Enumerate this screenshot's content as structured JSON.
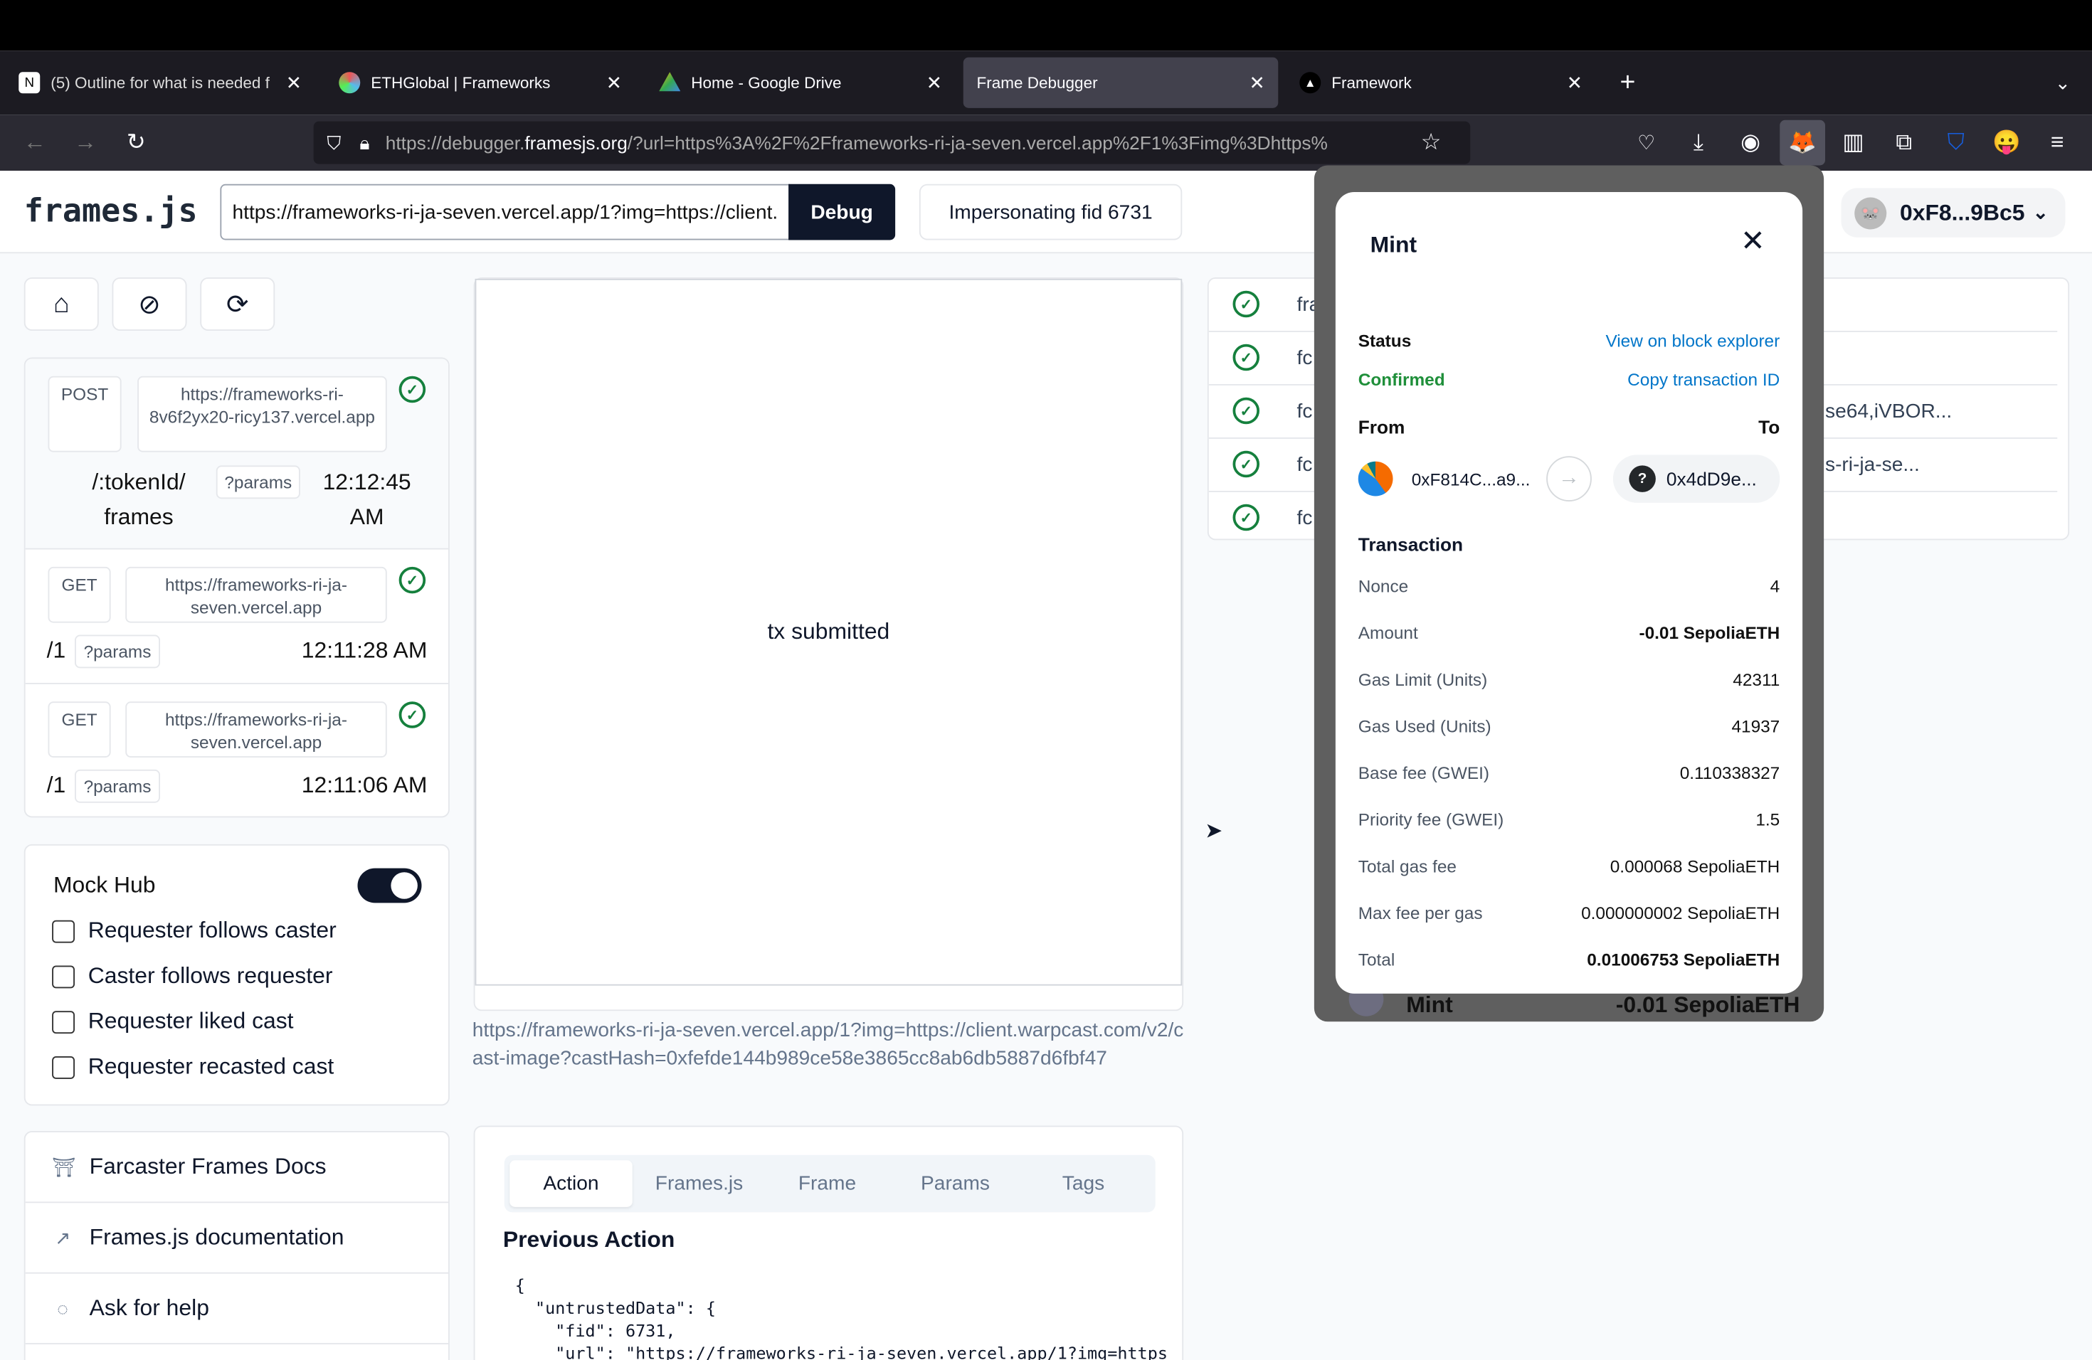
{
  "browser": {
    "tabs": [
      {
        "title": "(5) Outline for what is needed f",
        "icon": "notion-icon"
      },
      {
        "title": "ETHGlobal | Frameworks",
        "icon": "ethglobal-icon"
      },
      {
        "title": "Home - Google Drive",
        "icon": "google-drive-icon"
      },
      {
        "title": "Frame Debugger",
        "icon": "",
        "active": true
      },
      {
        "title": "Framework",
        "icon": "vercel-icon"
      }
    ],
    "url_prefix": "https://debugger.",
    "url_host": "framesjs.org",
    "url_rest": "/?url=https%3A%2F%2Fframeworks-ri-ja-seven.vercel.app%2F1%3Fimg%3Dhttps%"
  },
  "header": {
    "logo": "frames.js",
    "url_value": "https://frameworks-ri-ja-seven.vercel.app/1?img=https://client.warpcast.com/v2/cast-image?castHash=0xfefde144b989ce58e3865cc8ab6db5887d6fbf47",
    "debug_label": "Debug",
    "impersonate_label": "Impersonating fid 6731",
    "wallet_address": "0xF8...9Bc5"
  },
  "requests": [
    {
      "method": "POST",
      "host": "https://frameworks-ri-8v6f2yx20-ricy137.vercel.app",
      "path": "/:tokenId/ frames",
      "params": "?params",
      "time": "12:12:45 AM"
    },
    {
      "method": "GET",
      "host": "https://frameworks-ri-ja-seven.vercel.app",
      "path": "/1",
      "params": "?params",
      "time": "12:11:28 AM"
    },
    {
      "method": "GET",
      "host": "https://frameworks-ri-ja-seven.vercel.app",
      "path": "/1",
      "params": "?params",
      "time": "12:11:06 AM"
    }
  ],
  "mock_hub": {
    "label": "Mock Hub",
    "enabled": true,
    "options": [
      {
        "label": "Requester follows caster",
        "checked": false
      },
      {
        "label": "Caster follows requester",
        "checked": false
      },
      {
        "label": "Requester liked cast",
        "checked": false
      },
      {
        "label": "Requester recasted cast",
        "checked": false
      }
    ]
  },
  "links": [
    {
      "label": "Farcaster Frames Docs",
      "icon": "farcaster-icon"
    },
    {
      "label": "Frames.js documentation",
      "icon": "arrow-up-right-icon"
    },
    {
      "label": "Ask for help",
      "icon": "chat-icon"
    }
  ],
  "frame": {
    "image_text": "tx submitted",
    "url": "https://frameworks-ri-ja-seven.vercel.app/1?img=https://client.warpcast.com/v2/cast-image?castHash=0xfefde144b989ce58e3865cc8ab6db5887d6fbf47"
  },
  "inspector": {
    "tabs": [
      "Action",
      "Frames.js",
      "Frame",
      "Params",
      "Tags"
    ],
    "active_tab": "Action",
    "heading": "Previous Action",
    "code": "{\n  \"untrustedData\": {\n    \"fid\": 6731,\n    \"url\": \"https://frameworks-ri-ja-seven.vercel.app/1?img=https"
  },
  "diagnostics": {
    "rows": [
      {
        "left": "fra",
        "right": ""
      },
      {
        "left": "fc",
        "right": ""
      },
      {
        "left": "fc",
        "right": "se64,iVBOR..."
      },
      {
        "left": "fc",
        "right": "s-ri-ja-se..."
      },
      {
        "left": "fc",
        "right": ""
      }
    ]
  },
  "metamask": {
    "title": "Mint",
    "status_label": "Status",
    "status_value": "Confirmed",
    "view_explorer": "View on block explorer",
    "copy_tx": "Copy transaction ID",
    "from_label": "From",
    "to_label": "To",
    "from_address": "0xF814C...a9...",
    "to_address": "0x4dD9e...",
    "transaction_label": "Transaction",
    "details": [
      {
        "label": "Nonce",
        "value": "4"
      },
      {
        "label": "Amount",
        "value": "-0.01 SepoliaETH",
        "bold": true
      },
      {
        "label": "Gas Limit (Units)",
        "value": "42311"
      },
      {
        "label": "Gas Used (Units)",
        "value": "41937"
      },
      {
        "label": "Base fee (GWEI)",
        "value": "0.110338327"
      },
      {
        "label": "Priority fee (GWEI)",
        "value": "1.5"
      },
      {
        "label": "Total gas fee",
        "value": "0.000068 SepoliaETH"
      },
      {
        "label": "Max fee per gas",
        "value": "0.000000002 SepoliaETH"
      },
      {
        "label": "Total",
        "value": "0.01006753 SepoliaETH",
        "bold": true
      }
    ],
    "behind_title": "Mint",
    "behind_amount": "-0.01 SepoliaETH",
    "status_color": "#1f8f3a",
    "link_color": "#0376c9"
  }
}
